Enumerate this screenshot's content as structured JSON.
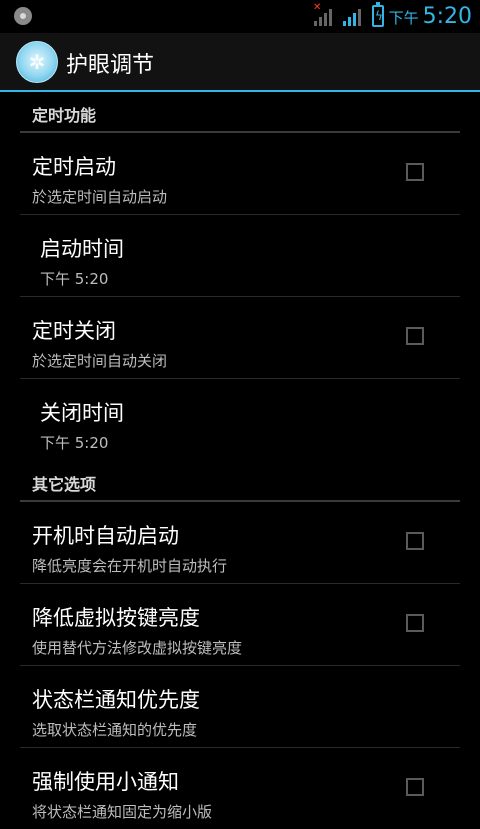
{
  "statusbar": {
    "ampm": "下午",
    "time": "5:20",
    "icons": [
      "app-notification-icon",
      "signal-no-sim-icon",
      "signal-icon",
      "battery-charging-icon"
    ],
    "accent": "#33b5e5"
  },
  "actionbar": {
    "title": "护眼调节",
    "icon": "app-gear-icon"
  },
  "sections": {
    "timer": {
      "header": "定时功能",
      "items": [
        {
          "title": "定时启动",
          "summary": "於选定时间自动启动",
          "checked": false
        },
        {
          "title": "启动时间",
          "summary": "下午 5:20"
        },
        {
          "title": "定时关闭",
          "summary": "於选定时间自动关闭",
          "checked": false
        },
        {
          "title": "关闭时间",
          "summary": "下午 5:20"
        }
      ]
    },
    "other": {
      "header": "其它选项",
      "items": [
        {
          "title": "开机时自动启动",
          "summary": "降低亮度会在开机时自动执行",
          "checked": false
        },
        {
          "title": "降低虚拟按键亮度",
          "summary": "使用替代方法修改虚拟按键亮度",
          "checked": false
        },
        {
          "title": "状态栏通知优先度",
          "summary": "选取状态栏通知的优先度"
        },
        {
          "title": "强制使用小通知",
          "summary": "将状态栏通知固定为缩小版",
          "checked": false
        }
      ]
    }
  }
}
